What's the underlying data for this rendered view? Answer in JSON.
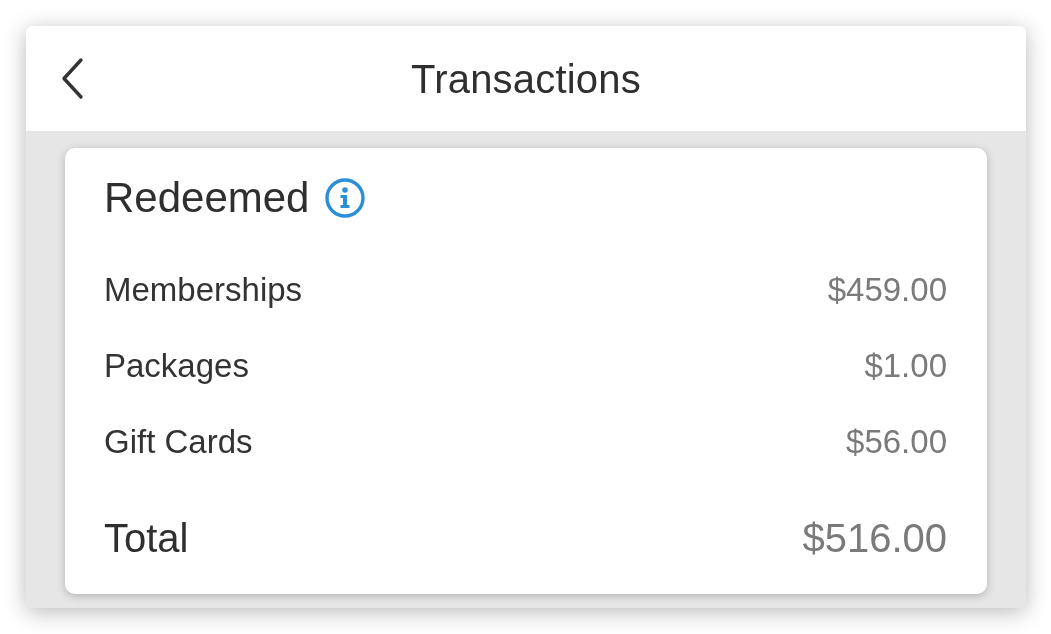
{
  "header": {
    "title": "Transactions"
  },
  "card": {
    "title": "Redeemed",
    "rows": [
      {
        "label": "Memberships",
        "amount": "$459.00"
      },
      {
        "label": "Packages",
        "amount": "$1.00"
      },
      {
        "label": "Gift Cards",
        "amount": "$56.00"
      }
    ],
    "total": {
      "label": "Total",
      "amount": "$516.00"
    }
  }
}
